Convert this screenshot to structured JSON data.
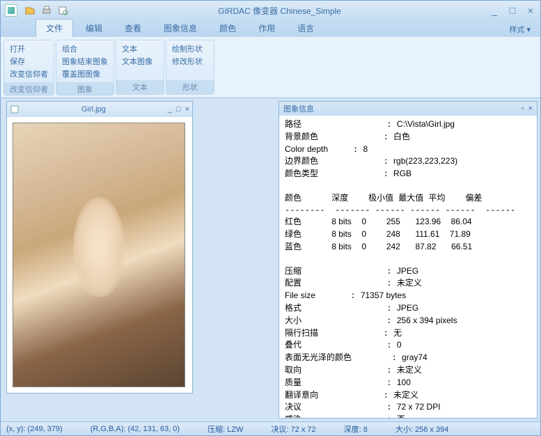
{
  "title": "GIRDAC 像变器 Chinese_Simple",
  "tabs": [
    "文件",
    "编辑",
    "查看",
    "图象信息",
    "颜色",
    "作用",
    "语言"
  ],
  "style_label": "样式 ▾",
  "ribbon": {
    "groups": [
      {
        "label": "改变信仰者",
        "items": [
          "打开",
          "保存",
          "改变信仰者"
        ]
      },
      {
        "label": "图象",
        "items": [
          "组合",
          "图象结束图象",
          "覆盖图图像"
        ]
      },
      {
        "label": "文本",
        "items": [
          "文本",
          "文本图像"
        ]
      },
      {
        "label": "形状",
        "items": [
          "绘制形状",
          "修改形状"
        ]
      }
    ]
  },
  "imgwin": {
    "title": "Girl.jpg",
    "min": "_",
    "max": "□",
    "close": "×"
  },
  "infopanel": {
    "title": "图象信息",
    "pin": "▫",
    "close": "×",
    "lines": {
      "path_l": "路径",
      "path_v": "C:\\Vista\\Girl.jpg",
      "bg_l": "背景颜色",
      "bg_v": "白色",
      "cd_l": "Color depth",
      "cd_v": "8",
      "bc_l": "边界颜色",
      "bc_v": "rgb(223,223,223)",
      "ct_l": "颜色类型",
      "ct_v": "RGB",
      "hdr_color": "颜色",
      "hdr_depth": "深度",
      "hdr_min": "极小值",
      "hdr_max": "最大值",
      "hdr_avg": "平均",
      "hdr_dev": "偏差",
      "r_l": "红色",
      "r_d": "8 bits",
      "r_min": "0",
      "r_max": "255",
      "r_avg": "123.96",
      "r_dev": "86.04",
      "g_l": "绿色",
      "g_d": "8 bits",
      "g_min": "0",
      "g_max": "248",
      "g_avg": "111.61",
      "g_dev": "71.89",
      "b_l": "蓝色",
      "b_d": "8 bits",
      "b_min": "0",
      "b_max": "242",
      "b_avg": "87.82",
      "b_dev": "66.51",
      "comp_l": "压缩",
      "comp_v": "JPEG",
      "cfg_l": "配置",
      "cfg_v": "未定义",
      "fs_l": "File size",
      "fs_v": "71357 bytes",
      "fmt_l": "格式",
      "fmt_v": "JPEG",
      "sz_l": "大小",
      "sz_v": "256 x 394 pixels",
      "il_l": "隔行扫描",
      "il_v": "无",
      "it_l": "叠代",
      "it_v": "0",
      "matte_l": "表面无光泽的颜色",
      "matte_v": "gray74",
      "or_l": "取向",
      "or_v": "未定义",
      "q_l": "质量",
      "q_v": "100",
      "ri_l": "翻译意向",
      "ri_v": "未定义",
      "res_l": "决议",
      "res_v": "72 x 72 DPI",
      "gm_l": "感染",
      "gm_v": "否"
    }
  },
  "status": {
    "xy": "(x, y): (249, 379)",
    "rgba": "(R,G,B,A): (42, 131, 63, 0)",
    "comp": "压缩: LZW",
    "res": "决议: 72 x 72",
    "depth": "深度: 8",
    "size": "大小: 256 x 394"
  }
}
